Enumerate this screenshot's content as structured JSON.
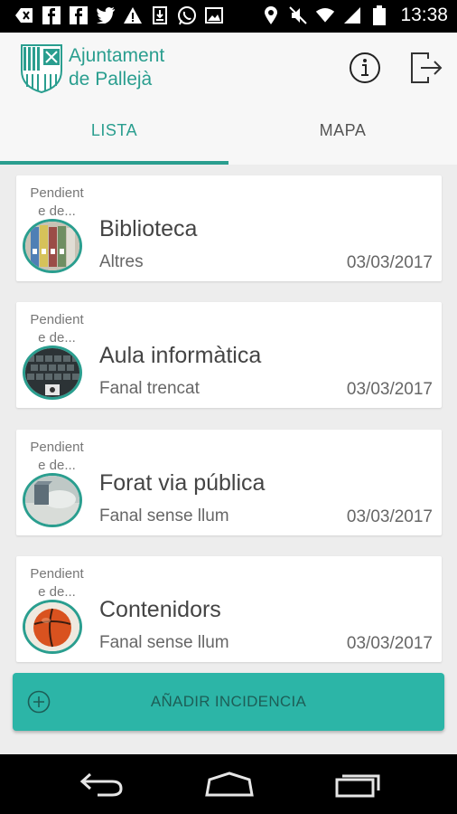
{
  "status_bar": {
    "time": "13:38",
    "left_icons": [
      "back-icon",
      "facebook-icon",
      "facebook-icon",
      "twitter-icon",
      "warning-icon",
      "download-icon",
      "whatsapp-icon",
      "image-icon"
    ],
    "right_icons": [
      "location-icon",
      "mute-icon",
      "wifi-icon",
      "signal-icon",
      "battery-icon"
    ]
  },
  "header": {
    "brand_line1": "Ajuntament",
    "brand_line2": "de Pallejà",
    "brand_color": "#2a9e8f",
    "info_icon": "info-icon",
    "logout_icon": "logout-icon"
  },
  "tabs": [
    {
      "label": "LISTA",
      "active": true
    },
    {
      "label": "MAPA",
      "active": false
    }
  ],
  "incidents": [
    {
      "status": "Pendient e de...",
      "title": "Biblioteca",
      "category": "Altres",
      "date": "03/03/2017",
      "thumb": "books"
    },
    {
      "status": "Pendient e de...",
      "title": "Aula informàtica",
      "category": "Fanal trencat",
      "date": "03/03/2017",
      "thumb": "keyboard"
    },
    {
      "status": "Pendient e de...",
      "title": "Forat via pública",
      "category": "Fanal sense llum",
      "date": "03/03/2017",
      "thumb": "desk"
    },
    {
      "status": "Pendient e de...",
      "title": "Contenidors",
      "category": "Fanal sense llum",
      "date": "03/03/2017",
      "thumb": "ball"
    }
  ],
  "add_button": {
    "label": "AÑADIR INCIDENCIA",
    "icon": "plus-circle-icon",
    "color": "#2cb5a7"
  },
  "nav_bar": {
    "icons": [
      "nav-back-icon",
      "nav-home-icon",
      "nav-recents-icon"
    ]
  }
}
